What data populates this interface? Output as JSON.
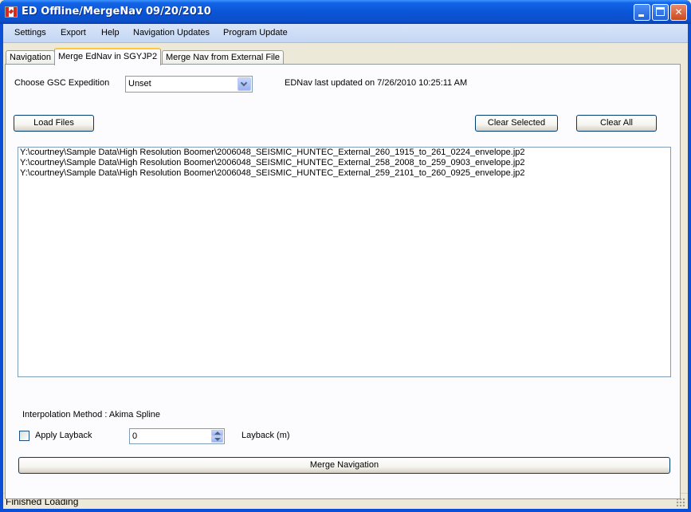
{
  "window": {
    "title": "ED Offline/MergeNav 09/20/2010",
    "minimize": "",
    "maximize": "",
    "close": "✕"
  },
  "menu": [
    "Settings",
    "Export",
    "Help",
    "Navigation Updates",
    "Program Update"
  ],
  "tabs": [
    "Navigation",
    "Merge EdNav in SGYJP2",
    "Merge Nav from External File"
  ],
  "active_tab": "Merge EdNav in SGYJP2",
  "panel": {
    "expedition_label": "Choose GSC  Expedition",
    "expedition_value": "Unset",
    "ednav_status": "EDNav last updated on 7/26/2010 10:25:11 AM",
    "load_files": "Load Files",
    "clear_selected": "Clear Selected",
    "clear_all": "Clear All",
    "files": [
      "Y:\\courtney\\Sample Data\\High Resolution Boomer\\2006048_SEISMIC_HUNTEC_External_260_1915_to_261_0224_envelope.jp2",
      "Y:\\courtney\\Sample Data\\High Resolution Boomer\\2006048_SEISMIC_HUNTEC_External_258_2008_to_259_0903_envelope.jp2",
      "Y:\\courtney\\Sample Data\\High Resolution Boomer\\2006048_SEISMIC_HUNTEC_External_259_2101_to_260_0925_envelope.jp2"
    ],
    "interpolation": "Interpolation Method : Akima Spline",
    "apply_layback": "Apply Layback",
    "layback_value": "0",
    "layback_unit": "Layback (m)",
    "merge_button": "Merge Navigation"
  },
  "status": "Finished Loading"
}
